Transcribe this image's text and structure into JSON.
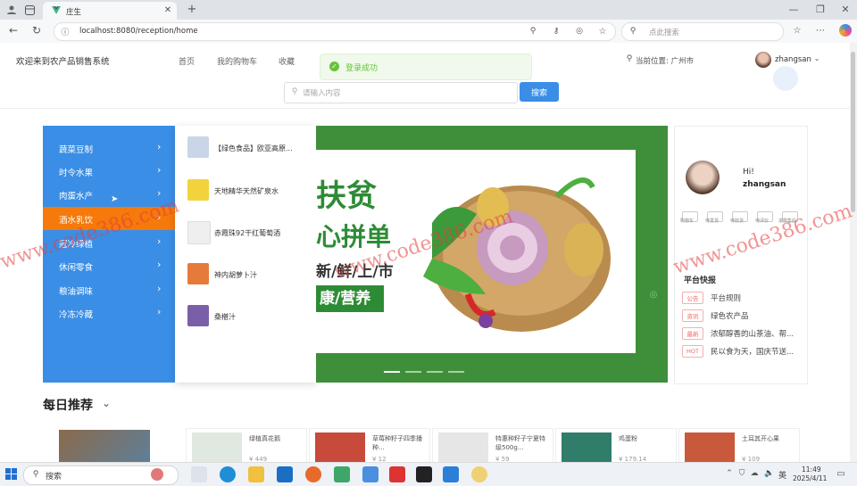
{
  "browser": {
    "tab_title": "庄生",
    "url": "localhost:8080/reception/home",
    "search_placeholder": "点此搜索"
  },
  "header": {
    "site_title": "欢迎来到农产品销售系统",
    "nav": [
      "首页",
      "我的购物车",
      "收藏"
    ],
    "location": "当前位置: 广州市",
    "username": "zhangsan",
    "toast": "登录成功",
    "search_placeholder": "请输入内容",
    "search_button": "搜索"
  },
  "categories": [
    "蔬菜豆制",
    "时令水果",
    "肉蛋水产",
    "酒水乳饮",
    "冠冷绿植",
    "休闲零食",
    "粮油调味",
    "冷冻冷藏"
  ],
  "active_category": 3,
  "flyout_products": [
    "【绿色食品】欧亚高原...",
    "天地精华天然矿泉水",
    "赤霞珠92干红葡萄酒",
    "神内胡萝卜汁",
    "桑椹汁"
  ],
  "banner": {
    "line1": "扶贫",
    "line2": "心拼单",
    "line3": "新/鲜/上/市",
    "line4": "康/营养"
  },
  "user_card": {
    "greeting": "Hi!",
    "name": "zhangsan",
    "quick_labels": [
      "购物车",
      "待发货",
      "待收货",
      "待评价",
      "退款售后"
    ],
    "notice_title": "平台快报",
    "notices": [
      {
        "tag": "公告",
        "text": "平台规则"
      },
      {
        "tag": "资讯",
        "text": "绿色农产品"
      },
      {
        "tag": "最新",
        "text": "浓郁醇香的山茶油、帮..."
      },
      {
        "tag": "HOT",
        "text": "民以食为天，国庆节送..."
      }
    ]
  },
  "daily": {
    "title": "每日推荐",
    "items": [
      "绿植真花鹅",
      "草莓种籽子四季播种...",
      "特惠种籽子宁夏特级500g...",
      "鸡蛋粉",
      "土耳其开心果"
    ],
    "prices": [
      "¥ 449",
      "¥ 12",
      "¥ 59",
      "¥ 179.14",
      "¥ 109"
    ]
  },
  "watermark": "www.code386.com",
  "taskbar": {
    "search": "搜索",
    "ime": "英",
    "time": "11:49",
    "date": "2025/4/11"
  },
  "colors": {
    "accent": "#3a8ee6",
    "active": "#f5790b",
    "banner": "#3f8f3a"
  }
}
